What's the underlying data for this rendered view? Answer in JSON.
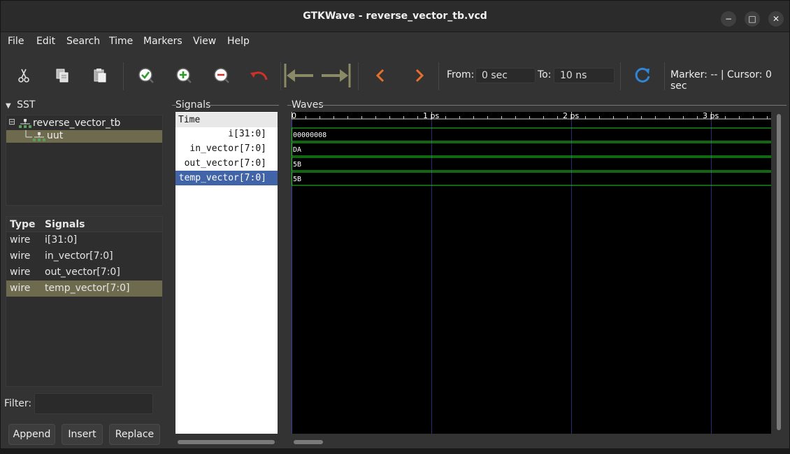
{
  "window": {
    "title": "GTKWave - reverse_vector_tb.vcd",
    "min_glyph": "−",
    "max_glyph": "□",
    "close_glyph": "✕"
  },
  "menu": [
    "File",
    "Edit",
    "Search",
    "Time",
    "Markers",
    "View",
    "Help"
  ],
  "toolbar": {
    "icons": [
      "cut-icon",
      "copy-icon",
      "paste-icon",
      "zoom-fit-icon",
      "zoom-in-icon",
      "zoom-out-icon",
      "undo-icon",
      "jump-start-icon",
      "jump-end-icon",
      "prev-icon",
      "next-icon",
      "reload-icon"
    ],
    "from_label": "From:",
    "from_value": "0 sec",
    "to_label": "To:",
    "to_value": "10 ns",
    "marker_text": "Marker: -- | Cursor: 0 sec"
  },
  "sst": {
    "label": "SST",
    "tree": [
      {
        "label": "reverse_vector_tb",
        "selected": false
      },
      {
        "label": "uut",
        "selected": true
      }
    ]
  },
  "signal_list": {
    "header_type": "Type",
    "header_signals": "Signals",
    "rows": [
      {
        "type": "wire",
        "name": "i[31:0]",
        "selected": false
      },
      {
        "type": "wire",
        "name": "in_vector[7:0]",
        "selected": false
      },
      {
        "type": "wire",
        "name": "out_vector[7:0]",
        "selected": false
      },
      {
        "type": "wire",
        "name": "temp_vector[7:0]",
        "selected": true
      }
    ]
  },
  "filter": {
    "label": "Filter:",
    "value": ""
  },
  "buttons": {
    "append": "Append",
    "insert": "Insert",
    "replace": "Replace"
  },
  "signals_pane": {
    "label": "Signals",
    "time_label": "Time",
    "names": [
      {
        "name": "i[31:0]",
        "selected": false
      },
      {
        "name": "in_vector[7:0]",
        "selected": false
      },
      {
        "name": "out_vector[7:0]",
        "selected": false
      },
      {
        "name": "temp_vector[7:0]",
        "selected": true
      }
    ]
  },
  "waves": {
    "label": "Waves",
    "ticks": [
      "0",
      "1 ps",
      "2 ps",
      "3 ps"
    ],
    "values": [
      "00000008",
      "DA",
      "5B",
      "5B"
    ],
    "colors": {
      "trace": "#22cc22",
      "grid": "#2a2a78",
      "text": "#ffffff"
    }
  }
}
